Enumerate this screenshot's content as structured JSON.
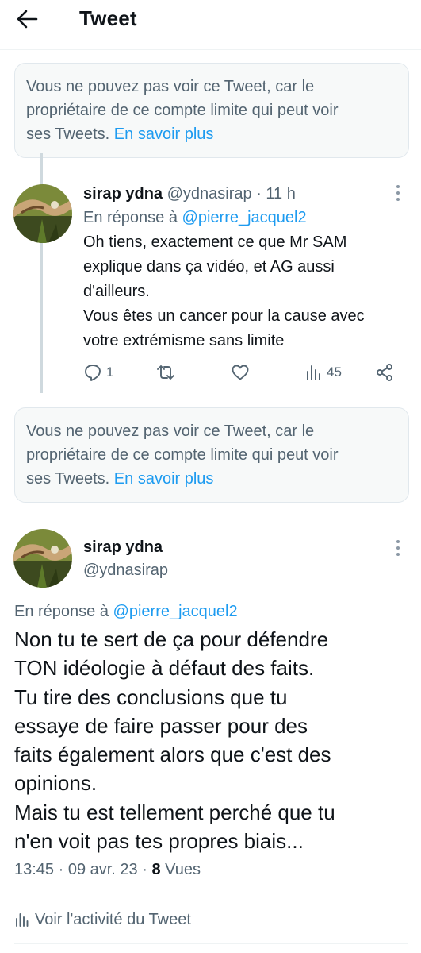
{
  "header": {
    "title": "Tweet"
  },
  "notice1": {
    "lines": [
      "Vous ne pouvez pas voir ce Tweet, car le",
      "propriétaire de ce compte limite qui peut voir",
      "ses Tweets."
    ],
    "link": "En savoir plus"
  },
  "reply": {
    "name": "sirap ydna",
    "handle": "@ydnasirap",
    "time": "· 11 h",
    "in_reply_prefix": "En réponse à",
    "in_reply_user": "@pierre_jacquel2",
    "body": [
      "Oh tiens, exactement ce que Mr SAM",
      "explique dans ça vidéo,  et AG aussi",
      "d'ailleurs.",
      "Vous êtes un cancer pour la cause avec",
      "votre extrémisme sans limite"
    ],
    "stats": {
      "replies": "1",
      "views": "45"
    }
  },
  "notice2": {
    "lines": [
      "Vous ne pouvez pas voir ce Tweet, car le",
      "propriétaire de ce compte limite qui peut voir",
      "ses Tweets."
    ],
    "link": "En savoir plus"
  },
  "main": {
    "name": "sirap ydna",
    "handle": "@ydnasirap",
    "in_reply_prefix": "En réponse à",
    "in_reply_user": "@pierre_jacquel2",
    "body": [
      "Non tu te sert de ça pour défendre",
      "TON idéologie à défaut des faits.",
      "Tu tire des conclusions que tu",
      "essaye de faire passer pour des",
      "faits également alors que c'est des",
      "opinions.",
      "Mais tu est tellement perché que tu",
      "n'en voit pas tes propres biais..."
    ],
    "timestamp": "13:45 · 09 avr. 23 ·",
    "views_count": "8",
    "views_label": "Vues",
    "activity": "Voir l'activité du Tweet"
  },
  "colors": {
    "accent": "#1d9bf0",
    "muted": "#536471",
    "text": "#0f1419"
  },
  "icons": [
    "back-arrow-icon",
    "more-icon",
    "reply-icon",
    "retweet-icon",
    "like-icon",
    "views-icon",
    "share-icon",
    "analytics-icon"
  ]
}
